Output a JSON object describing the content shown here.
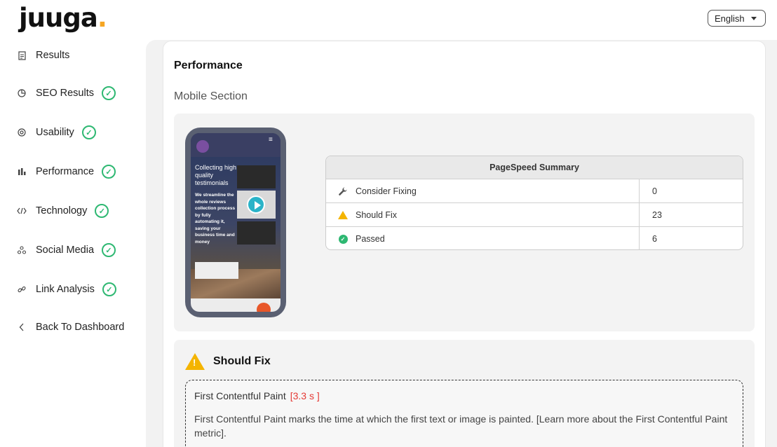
{
  "header": {
    "logo_text": "juuga",
    "logo_dot": ".",
    "language": "English"
  },
  "sidebar": {
    "items": [
      {
        "label": "Results",
        "icon": "document-icon",
        "checked": false
      },
      {
        "label": "SEO Results",
        "icon": "pie-chart-icon",
        "checked": true
      },
      {
        "label": "Usability",
        "icon": "usability-icon",
        "checked": true
      },
      {
        "label": "Performance",
        "icon": "bar-chart-icon",
        "checked": true
      },
      {
        "label": "Technology",
        "icon": "code-icon",
        "checked": true
      },
      {
        "label": "Social Media",
        "icon": "social-icon",
        "checked": true
      },
      {
        "label": "Link Analysis",
        "icon": "link-icon",
        "checked": true
      },
      {
        "label": "Back To Dashboard",
        "icon": "chevron-left-icon",
        "checked": false
      }
    ],
    "check_glyph": "✓"
  },
  "main": {
    "title": "Performance",
    "section_title": "Mobile Section",
    "phone_preview": {
      "headline": "Collecting high quality testimonials",
      "subtext": "We streamline the whole reviews collection process by fully automating it, saving your business time and money"
    },
    "pagespeed": {
      "title": "PageSpeed Summary",
      "rows": [
        {
          "label": "Consider Fixing",
          "value": "0",
          "icon": "wrench-icon"
        },
        {
          "label": "Should Fix",
          "value": "23",
          "icon": "warning-icon"
        },
        {
          "label": "Passed",
          "value": "6",
          "icon": "check-circle-icon"
        }
      ]
    },
    "should_fix": {
      "title": "Should Fix",
      "audit": {
        "name": "First Contentful Paint",
        "metric": "[3.3 s ]",
        "description": "First Contentful Paint marks the time at which the first text or image is painted. [Learn more about the First Contentful Paint metric]."
      }
    }
  },
  "colors": {
    "accent_green": "#2eb872",
    "warning": "#f4b400",
    "error": "#e53935",
    "logo_dot": "#f5a623"
  }
}
